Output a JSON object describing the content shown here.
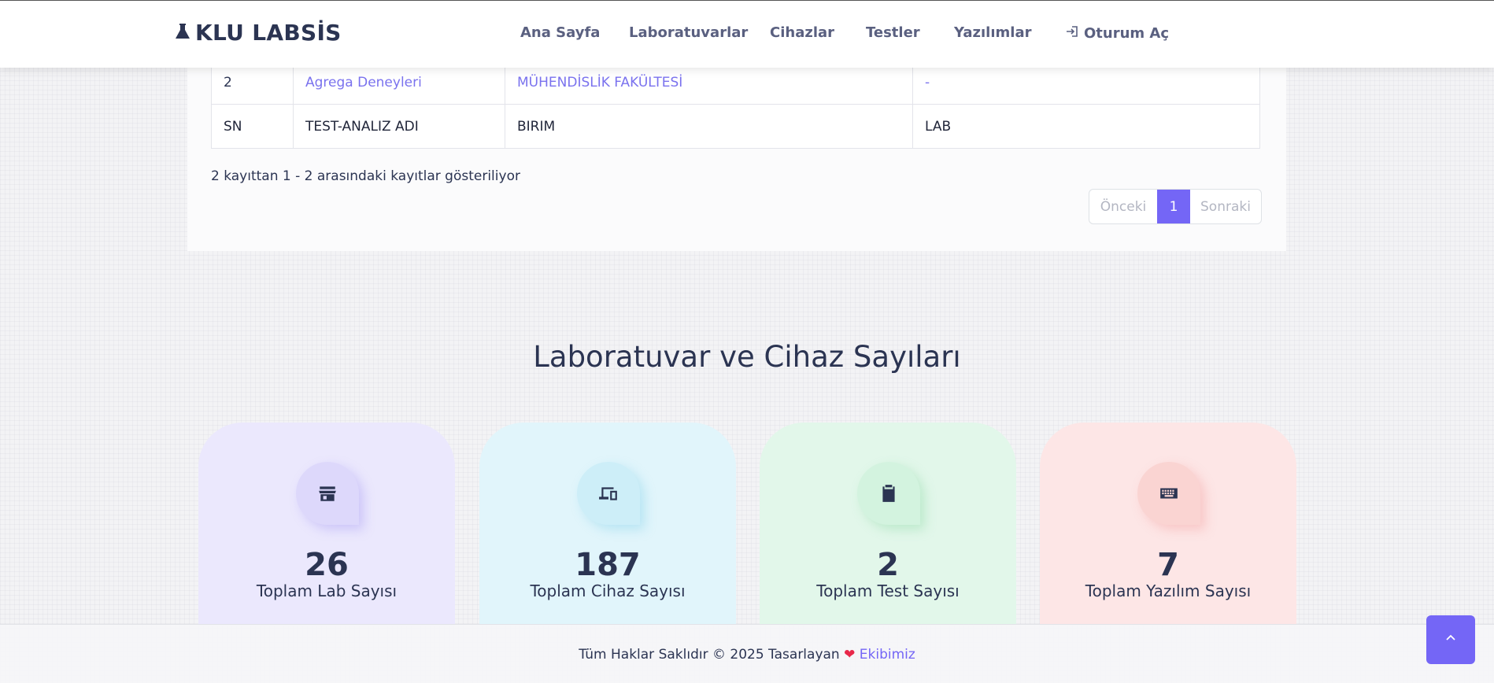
{
  "header": {
    "brand": "KLU LABSİS",
    "nav": [
      {
        "label": "Ana Sayfa"
      },
      {
        "label": "Laboratuvarlar"
      },
      {
        "label": "Cihazlar"
      },
      {
        "label": "Testler"
      },
      {
        "label": "Yazılımlar"
      },
      {
        "label": "Oturum Aç",
        "icon": "login-icon"
      }
    ]
  },
  "table": {
    "rows": [
      {
        "sn": "2",
        "name": "Agrega Deneyleri",
        "unit": "MÜHENDİSLİK FAKÜLTESİ",
        "lab": "-"
      }
    ],
    "footer": {
      "sn": "SN",
      "name": "TEST-ANALIZ ADI",
      "unit": "BIRIM",
      "lab": "LAB"
    },
    "info": "2 kayıttan 1 - 2 arasındaki kayıtlar gösteriliyor",
    "pagination": {
      "prev": "Önceki",
      "current": "1",
      "next": "Sonraki"
    }
  },
  "stats": {
    "title": "Laboratuvar ve Cihaz Sayıları",
    "items": [
      {
        "value": "26",
        "label": "Toplam Lab Sayısı",
        "icon": "store-icon",
        "color": "#ebe8fd"
      },
      {
        "value": "187",
        "label": "Toplam Cihaz Sayısı",
        "icon": "devices-icon",
        "color": "#e1f5fb"
      },
      {
        "value": "2",
        "label": "Toplam Test Sayısı",
        "icon": "clipboard-icon",
        "color": "#e2f7ea"
      },
      {
        "value": "7",
        "label": "Toplam Yazılım Sayısı",
        "icon": "keyboard-icon",
        "color": "#fde6e6"
      }
    ]
  },
  "footer": {
    "text": "Tüm Haklar Saklıdır © 2025 Tasarlayan",
    "link": "Ekibimiz"
  },
  "colors": {
    "accent": "#7466f6",
    "text": "#2b3452",
    "heart": "#e8284a"
  }
}
